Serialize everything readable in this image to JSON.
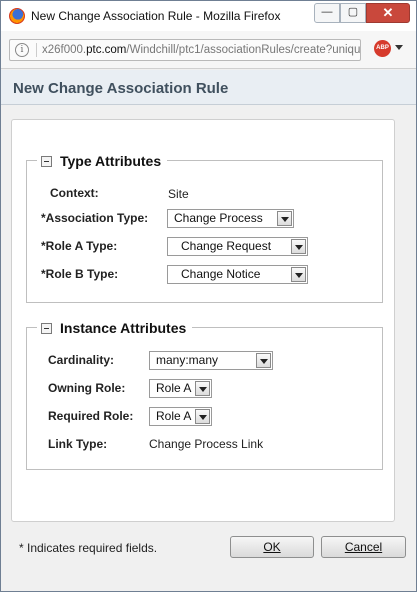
{
  "window": {
    "title": "New Change Association Rule - Mozilla Firefox",
    "minimize_glyph": "—",
    "maximize_glyph": "▢",
    "close_glyph": "✕"
  },
  "urlbar": {
    "info_glyph": "i",
    "url_prefix": "x26f000.",
    "url_domain": "ptc.com",
    "url_path": "/Windchill/ptc1/associationRules/create?uniqu",
    "addon_label": "ABP"
  },
  "page": {
    "title": "New Change Association Rule"
  },
  "type_attributes": {
    "legend": "Type Attributes",
    "context_label": "Context:",
    "context_value": "Site",
    "association_type_label": "*Association Type:",
    "association_type_value": "Change Process",
    "role_a_type_label": "*Role A Type:",
    "role_a_type_value": "Change Request",
    "role_b_type_label": "*Role B Type:",
    "role_b_type_value": "Change Notice"
  },
  "instance_attributes": {
    "legend": "Instance Attributes",
    "cardinality_label": "Cardinality:",
    "cardinality_value": "many:many",
    "owning_role_label": "Owning Role:",
    "owning_role_value": "Role A",
    "required_role_label": "Required Role:",
    "required_role_value": "Role A",
    "link_type_label": "Link Type:",
    "link_type_value": "Change Process Link"
  },
  "footer": {
    "required_note": "* Indicates required fields.",
    "ok_label": "OK",
    "cancel_label": "Cancel"
  },
  "colors": {
    "header_background": "#e9eef3",
    "close_button": "#c9483c",
    "addon_badge": "#d63a2c"
  },
  "icons": {
    "browser": "firefox-icon",
    "site_info": "info-icon",
    "addon": "adblock-plus-icon",
    "group_toggle": "collapse-icon",
    "dropdown": "dropdown-arrow-icon"
  }
}
